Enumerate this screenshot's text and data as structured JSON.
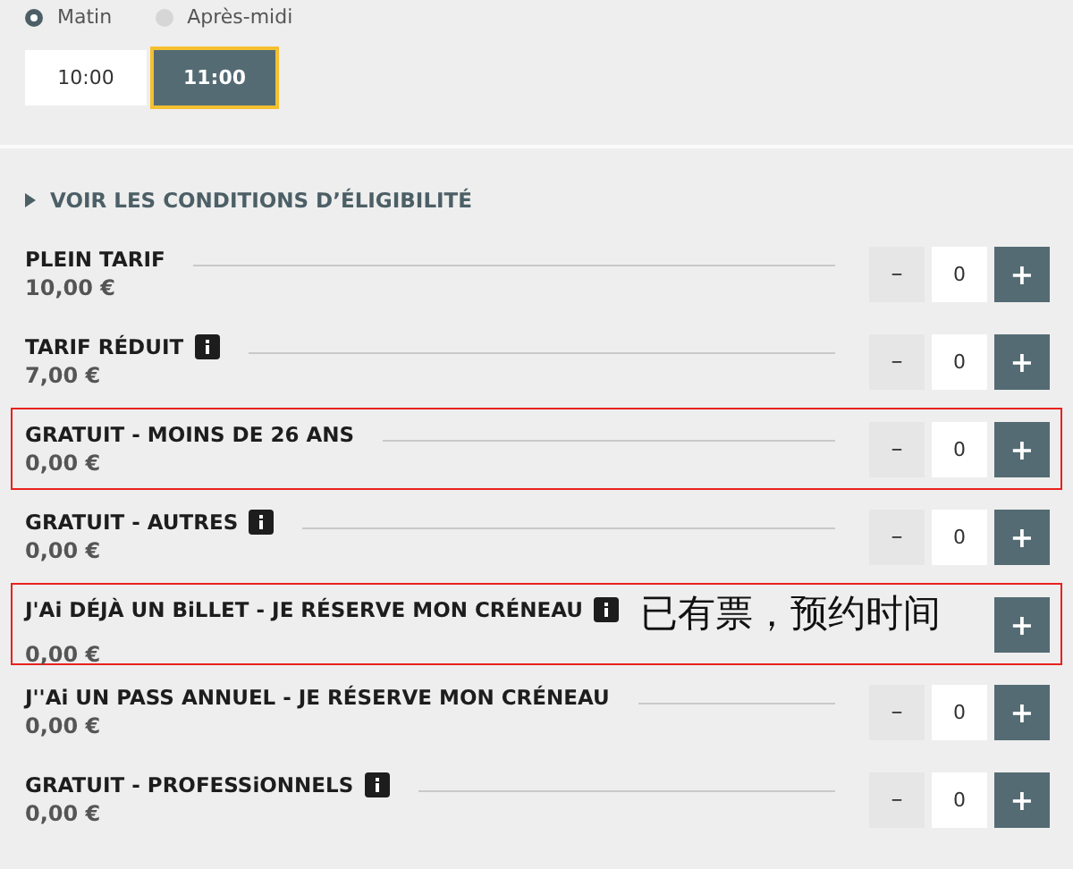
{
  "period_options": [
    {
      "label": "Matin",
      "selected": true
    },
    {
      "label": "Après-midi",
      "selected": false
    }
  ],
  "time_slots": [
    {
      "label": "10:00",
      "selected": false
    },
    {
      "label": "11:00",
      "selected": true
    }
  ],
  "eligibility_link": "VOIR LES CONDITIONS D’ÉLIGIBILITÉ",
  "tickets": [
    {
      "name": "PLEIN TARIF",
      "price": "10,00 €",
      "info": false,
      "highlighted": false,
      "minus": "–",
      "quantity": "0",
      "plus": "+"
    },
    {
      "name": "TARIF RÉDUIT",
      "price": "7,00 €",
      "info": true,
      "highlighted": false,
      "minus": "–",
      "quantity": "0",
      "plus": "+"
    },
    {
      "name": "GRATUIT - MOINS DE 26 ANS",
      "price": "0,00 €",
      "info": false,
      "highlighted": true,
      "minus": "–",
      "quantity": "0",
      "plus": "+"
    },
    {
      "name": "GRATUIT - AUTRES",
      "price": "0,00 €",
      "info": true,
      "highlighted": false,
      "minus": "–",
      "quantity": "0",
      "plus": "+"
    },
    {
      "name": "J'Ai DÉJÀ UN BiLLET - JE RÉSERVE MON CRÉNEAU",
      "price": "0,00 €",
      "info": true,
      "highlighted": true,
      "note": "已有票，预约时间",
      "plus": "+"
    },
    {
      "name": "J''Ai UN PASS ANNUEL - JE RÉSERVE MON CRÉNEAU",
      "price": "0,00 €",
      "info": false,
      "highlighted": false,
      "minus": "–",
      "quantity": "0",
      "plus": "+"
    },
    {
      "name": "GRATUIT - PROFESSiONNELS",
      "price": "0,00 €",
      "info": true,
      "highlighted": false,
      "minus": "–",
      "quantity": "0",
      "plus": "+"
    }
  ]
}
